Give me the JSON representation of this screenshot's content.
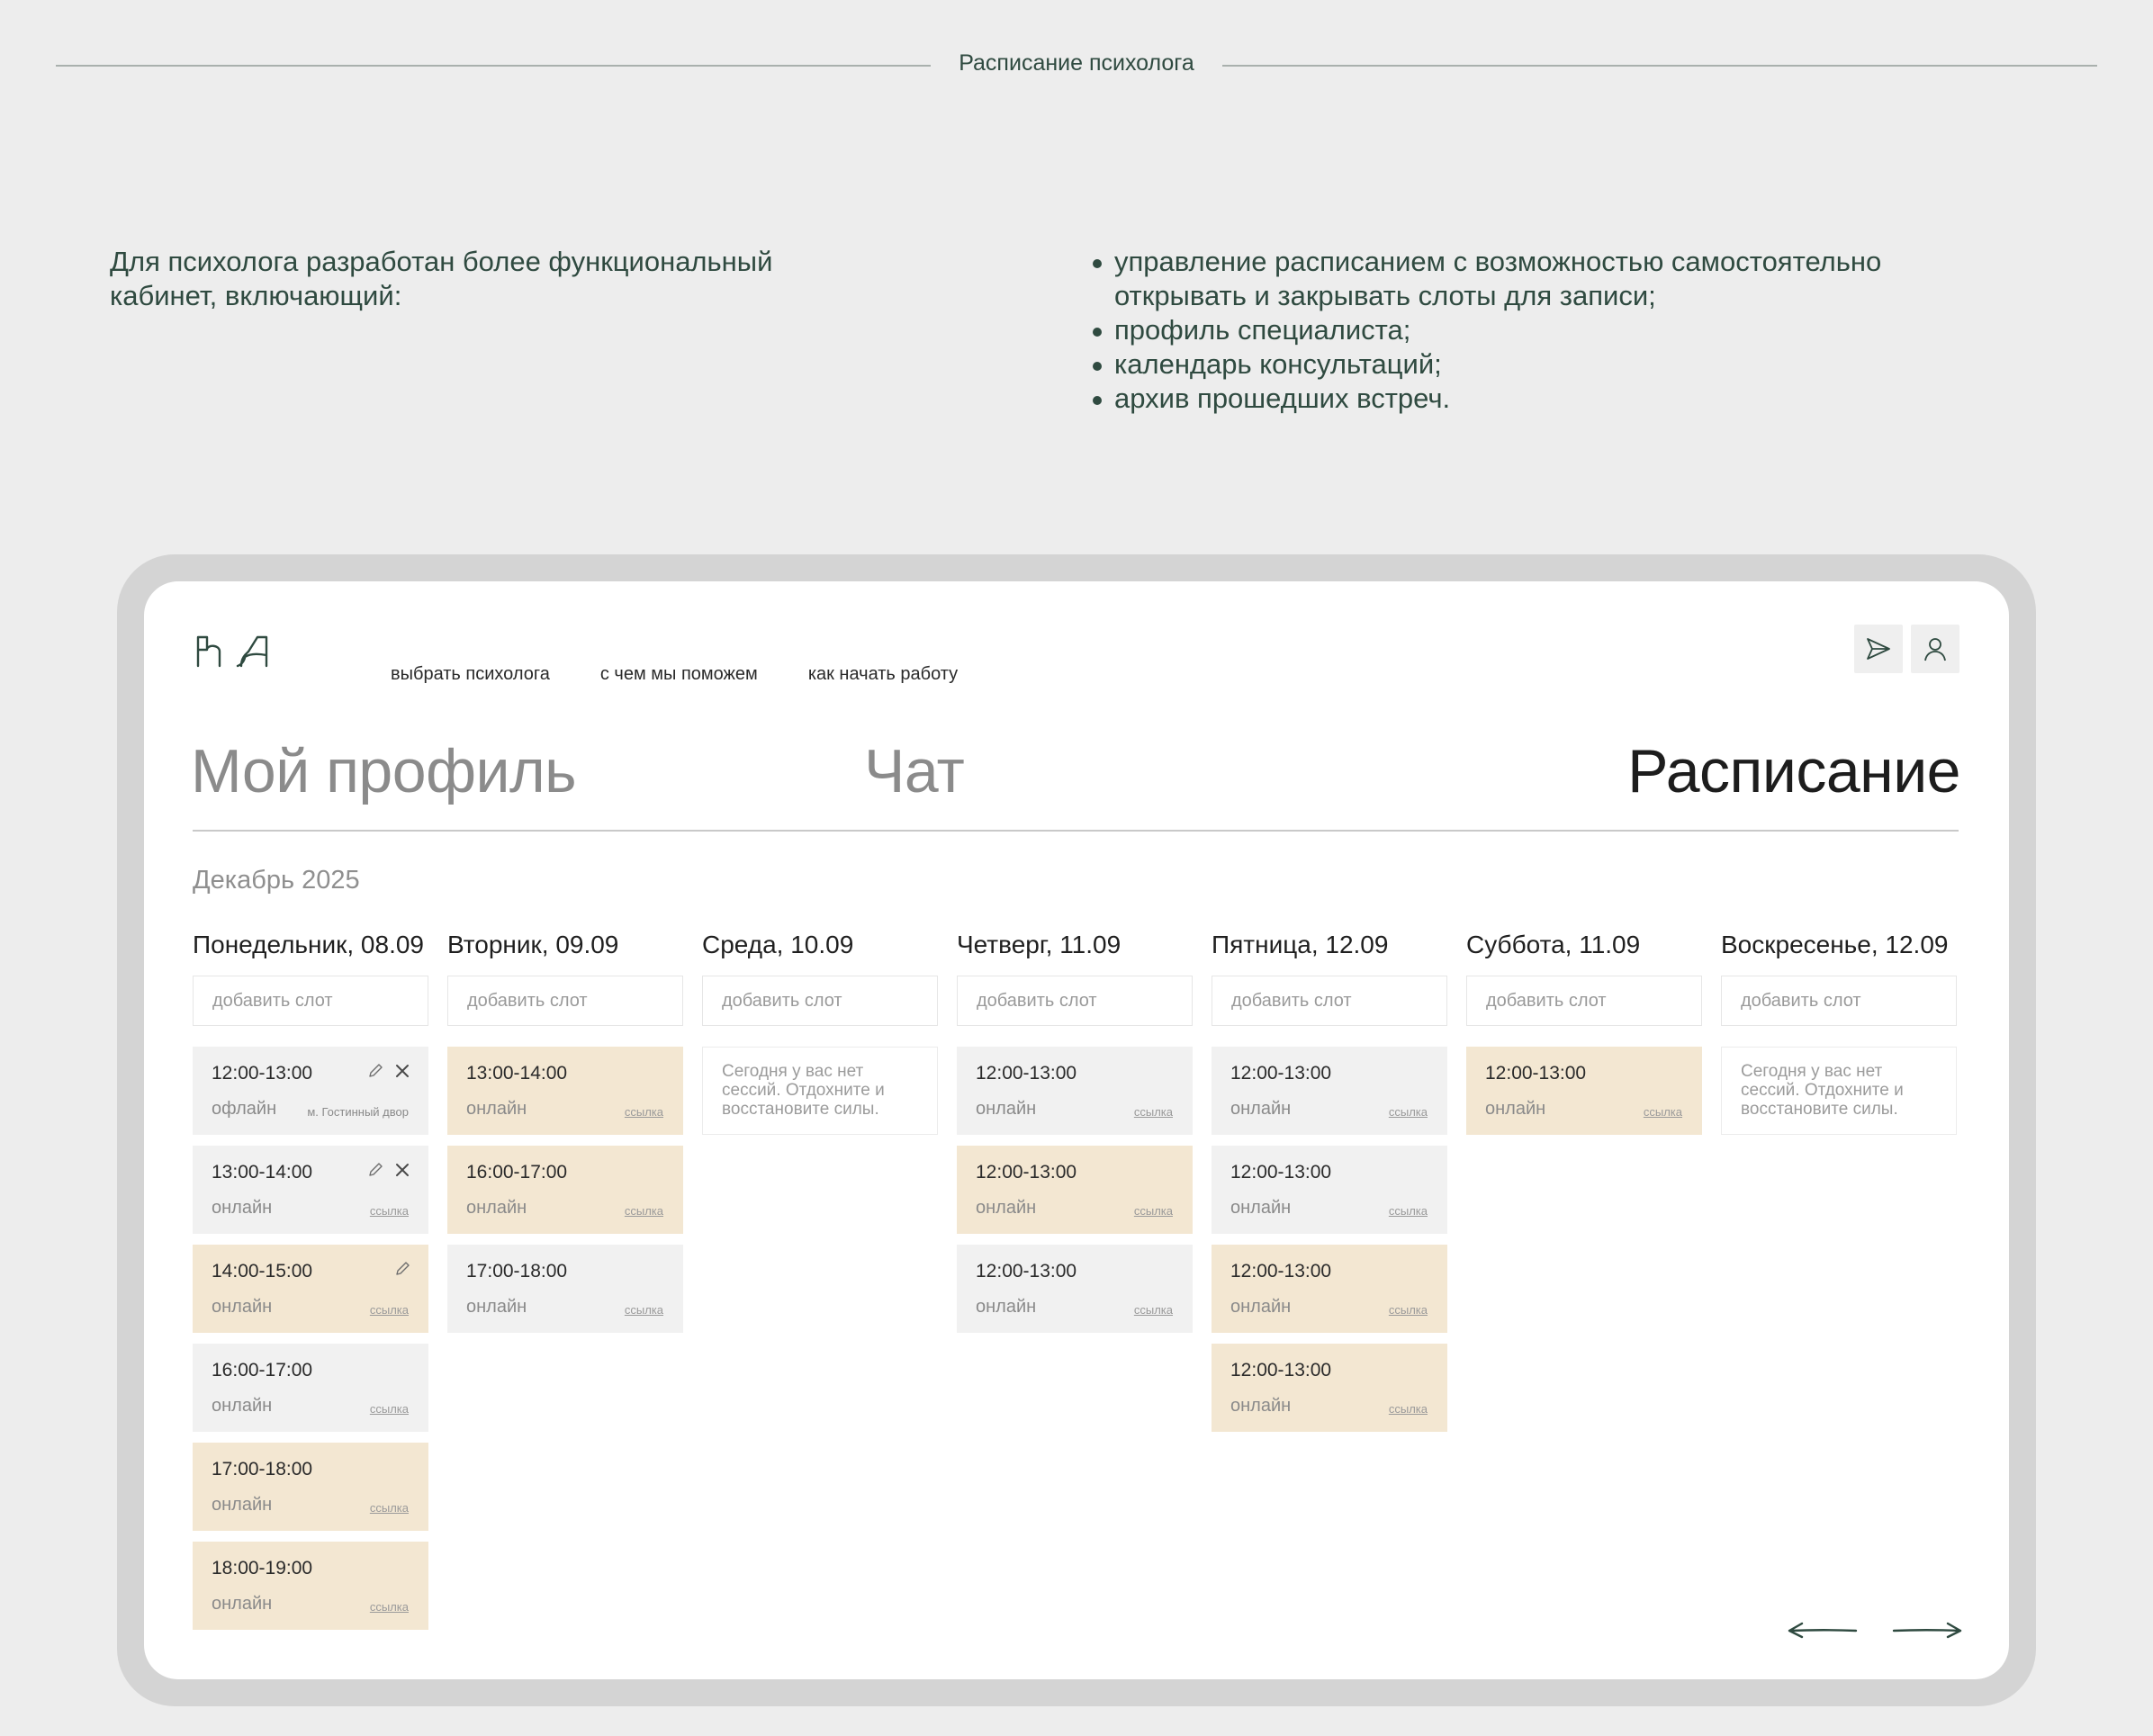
{
  "section_title": "Расписание психолога",
  "intro_text": "Для психолога разработан более функциональный кабинет, включающий:",
  "features": [
    "управление расписанием с возможностью самостоятельно открывать и закрывать слоты для записи;",
    "профиль специалиста;",
    "календарь консультаций;",
    "архив прошедших встреч."
  ],
  "nav": [
    "выбрать психолога",
    "с чем мы поможем",
    "как начать работу"
  ],
  "tabs": {
    "profile": "Мой профиль",
    "chat": "Чат",
    "schedule": "Расписание"
  },
  "month": "Декабрь 2025",
  "add_slot_label": "добавить слот",
  "link_label": "ссылка",
  "empty_text": "Сегодня у вас нет сессий. Отдохните и восстановите силы.",
  "colors": {
    "booked": "#f3e7d2",
    "free": "#f1f1f1",
    "accent": "#2f4a40"
  },
  "days": [
    {
      "title": "Понедельник, 08.09",
      "slots": [
        {
          "time": "12:00-13:00",
          "mode": "офлайн",
          "place": "м. Гостинный двор",
          "booked": false,
          "actions": [
            "pencil-icon",
            "close-icon"
          ]
        },
        {
          "time": "13:00-14:00",
          "mode": "онлайн",
          "link": true,
          "booked": false,
          "actions": [
            "pencil-icon",
            "close-icon"
          ]
        },
        {
          "time": "14:00-15:00",
          "mode": "онлайн",
          "link": true,
          "booked": true,
          "actions": [
            "pencil-icon"
          ]
        },
        {
          "time": "16:00-17:00",
          "mode": "онлайн",
          "link": true,
          "booked": false
        },
        {
          "time": "17:00-18:00",
          "mode": "онлайн",
          "link": true,
          "booked": true
        },
        {
          "time": "18:00-19:00",
          "mode": "онлайн",
          "link": true,
          "booked": true
        }
      ]
    },
    {
      "title": "Вторник, 09.09",
      "slots": [
        {
          "time": "13:00-14:00",
          "mode": "онлайн",
          "link": true,
          "booked": true
        },
        {
          "time": "16:00-17:00",
          "mode": "онлайн",
          "link": true,
          "booked": true
        },
        {
          "time": "17:00-18:00",
          "mode": "онлайн",
          "link": true,
          "booked": false
        }
      ]
    },
    {
      "title": "Среда, 10.09",
      "slots": [],
      "empty": true
    },
    {
      "title": "Четверг, 11.09",
      "slots": [
        {
          "time": "12:00-13:00",
          "mode": "онлайн",
          "link": true,
          "booked": false
        },
        {
          "time": "12:00-13:00",
          "mode": "онлайн",
          "link": true,
          "booked": true
        },
        {
          "time": "12:00-13:00",
          "mode": "онлайн",
          "link": true,
          "booked": false
        }
      ]
    },
    {
      "title": "Пятница, 12.09",
      "slots": [
        {
          "time": "12:00-13:00",
          "mode": "онлайн",
          "link": true,
          "booked": false
        },
        {
          "time": "12:00-13:00",
          "mode": "онлайн",
          "link": true,
          "booked": false
        },
        {
          "time": "12:00-13:00",
          "mode": "онлайн",
          "link": true,
          "booked": true
        },
        {
          "time": "12:00-13:00",
          "mode": "онлайн",
          "link": true,
          "booked": true
        }
      ]
    },
    {
      "title": "Суббота, 11.09",
      "slots": [
        {
          "time": "12:00-13:00",
          "mode": "онлайн",
          "link": true,
          "booked": true
        }
      ]
    },
    {
      "title": "Воскресенье, 12.09",
      "slots": [],
      "empty": true
    }
  ],
  "icons": {
    "logo": "hands-logo-icon",
    "send": "send-icon",
    "user": "user-icon",
    "prev": "arrow-left-icon",
    "next": "arrow-right-icon"
  }
}
